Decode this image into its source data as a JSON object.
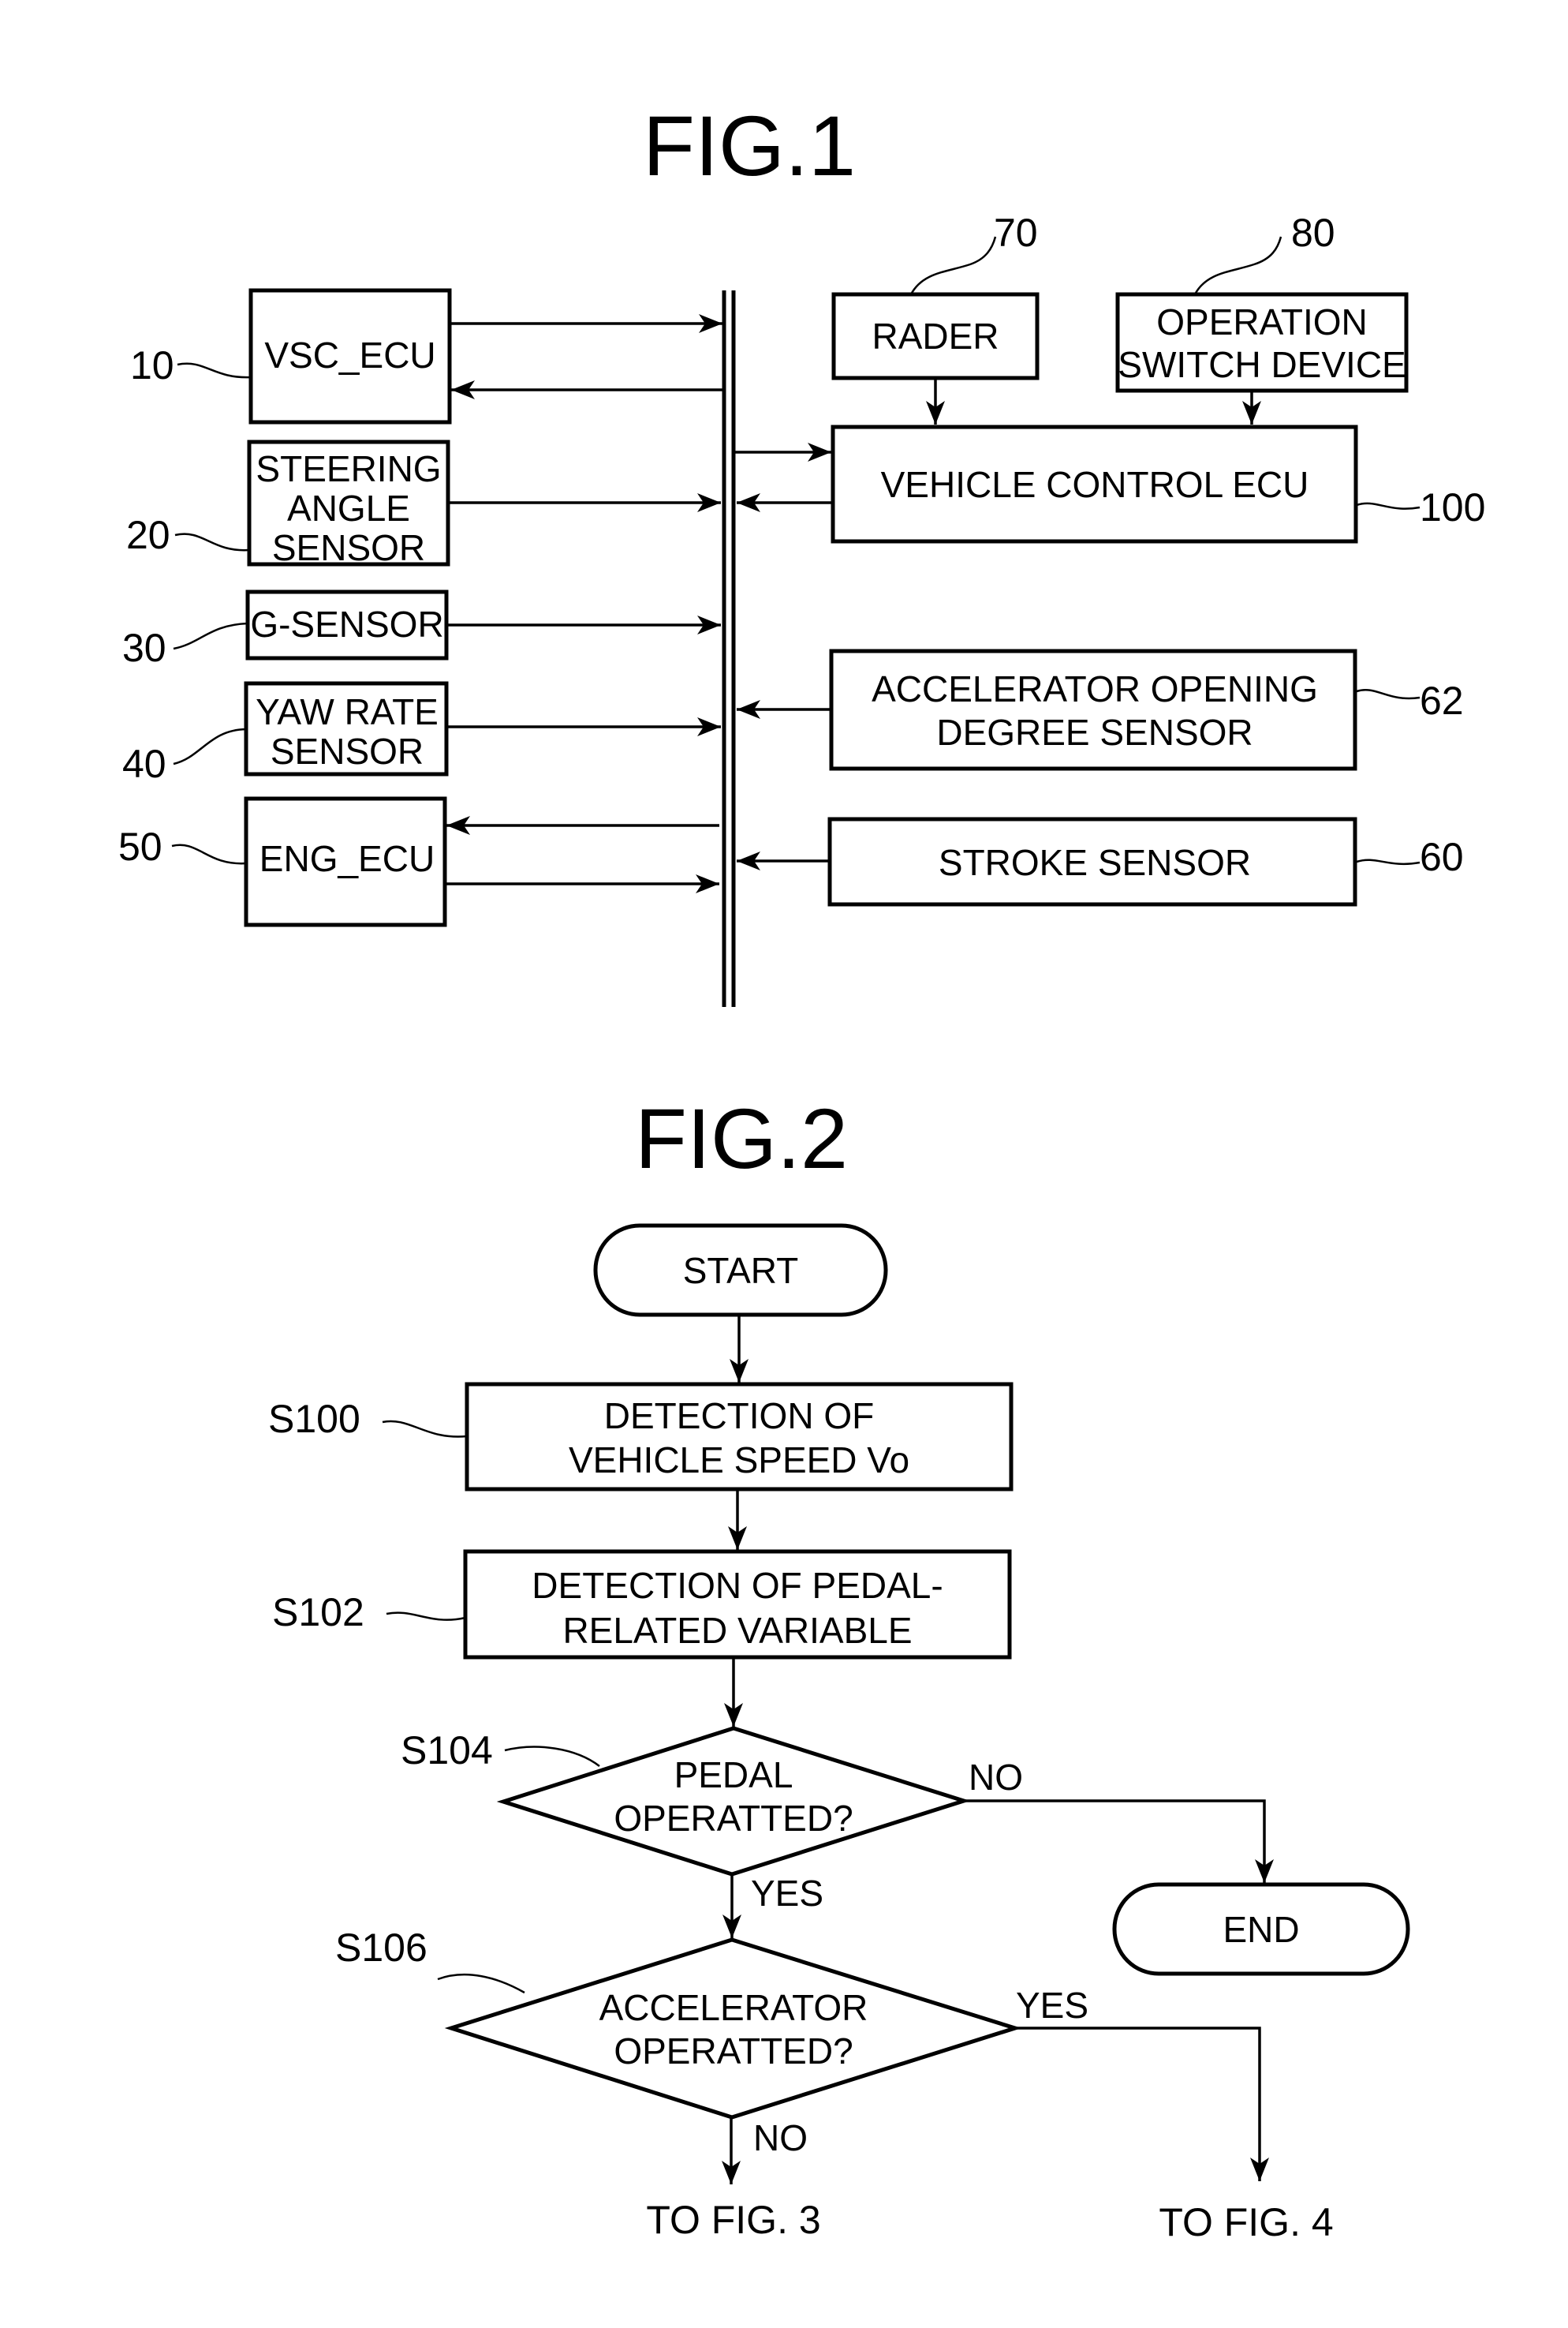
{
  "figures": [
    {
      "title": "FIG.1",
      "blocks": [
        {
          "id": "vsc",
          "ref": "10",
          "lines": [
            "VSC_ECU"
          ]
        },
        {
          "id": "steer",
          "ref": "20",
          "lines": [
            "STEERING",
            "ANGLE",
            "SENSOR"
          ]
        },
        {
          "id": "g",
          "ref": "30",
          "lines": [
            "G-SENSOR"
          ]
        },
        {
          "id": "yaw",
          "ref": "40",
          "lines": [
            "YAW RATE",
            "SENSOR"
          ]
        },
        {
          "id": "eng",
          "ref": "50",
          "lines": [
            "ENG_ECU"
          ]
        },
        {
          "id": "rader",
          "ref": "70",
          "lines": [
            "RADER"
          ]
        },
        {
          "id": "opsw",
          "ref": "80",
          "lines": [
            "OPERATION",
            "SWITCH DEVICE"
          ]
        },
        {
          "id": "vce",
          "ref": "100",
          "lines": [
            "VEHICLE CONTROL ECU"
          ]
        },
        {
          "id": "acc",
          "ref": "62",
          "lines": [
            "ACCELERATOR OPENING",
            "DEGREE SENSOR"
          ]
        },
        {
          "id": "stroke",
          "ref": "60",
          "lines": [
            "STROKE SENSOR"
          ]
        }
      ]
    },
    {
      "title": "FIG.2",
      "nodes": [
        {
          "id": "start",
          "type": "terminal",
          "lines": [
            "START"
          ]
        },
        {
          "id": "s100",
          "type": "process",
          "step": "S100",
          "lines": [
            "DETECTION OF",
            "VEHICLE SPEED Vo"
          ]
        },
        {
          "id": "s102",
          "type": "process",
          "step": "S102",
          "lines": [
            "DETECTION OF PEDAL-",
            "RELATED VARIABLE"
          ]
        },
        {
          "id": "s104",
          "type": "decision",
          "step": "S104",
          "lines": [
            "PEDAL",
            "OPERATTED?"
          ]
        },
        {
          "id": "end",
          "type": "terminal",
          "lines": [
            "END"
          ]
        },
        {
          "id": "s106",
          "type": "decision",
          "step": "S106",
          "lines": [
            "ACCELERATOR",
            "OPERATTED?"
          ]
        }
      ],
      "edge_labels": {
        "s104_no": "NO",
        "s104_yes": "YES",
        "s106_yes": "YES",
        "s106_no": "NO"
      },
      "connectors": {
        "to_fig3": "TO FIG. 3",
        "to_fig4": "TO FIG. 4"
      }
    }
  ]
}
